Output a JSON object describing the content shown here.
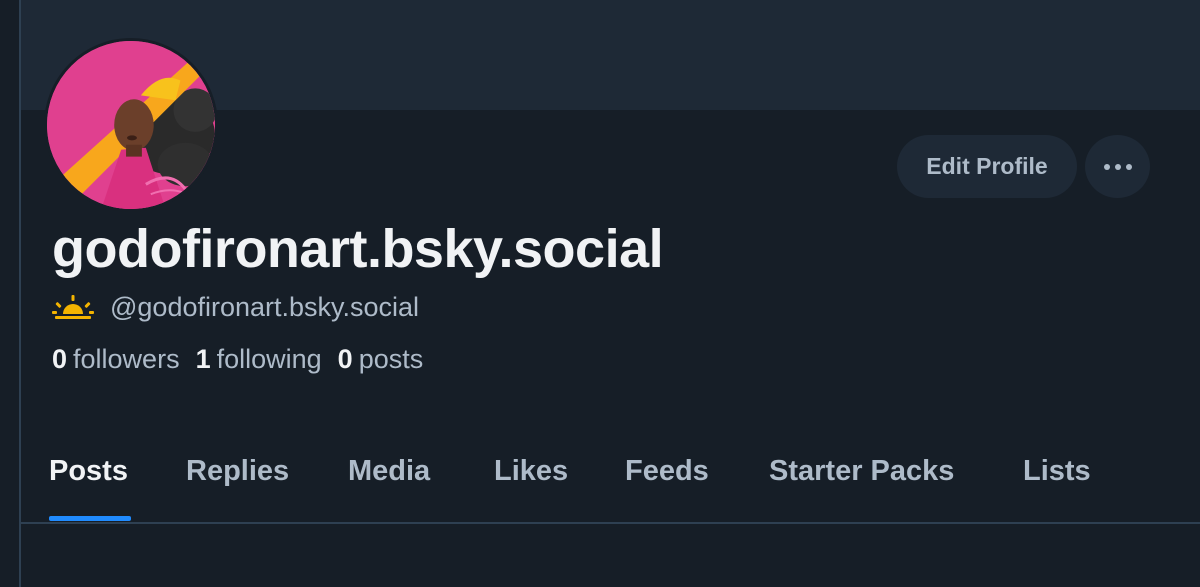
{
  "profile": {
    "display_name": "godofironart.bsky.social",
    "handle": "@godofironart.bsky.social",
    "handle_icon": "sunrise-icon",
    "avatar_icon": "avatar-illustration"
  },
  "actions": {
    "edit_profile_label": "Edit Profile",
    "more_icon": "ellipsis-icon"
  },
  "stats": {
    "followers_count": "0",
    "followers_label": "followers",
    "following_count": "1",
    "following_label": "following",
    "posts_count": "0",
    "posts_label": "posts"
  },
  "tabs": [
    {
      "label": "Posts",
      "active": true
    },
    {
      "label": "Replies",
      "active": false
    },
    {
      "label": "Media",
      "active": false
    },
    {
      "label": "Likes",
      "active": false
    },
    {
      "label": "Feeds",
      "active": false
    },
    {
      "label": "Starter Packs",
      "active": false
    },
    {
      "label": "Lists",
      "active": false
    }
  ],
  "colors": {
    "background": "#161e27",
    "banner": "#1e2936",
    "accent": "#208bfe",
    "primary_text": "#f1f3f5",
    "secondary_text": "#aebbc9",
    "handle_icon": "#f4b400"
  }
}
